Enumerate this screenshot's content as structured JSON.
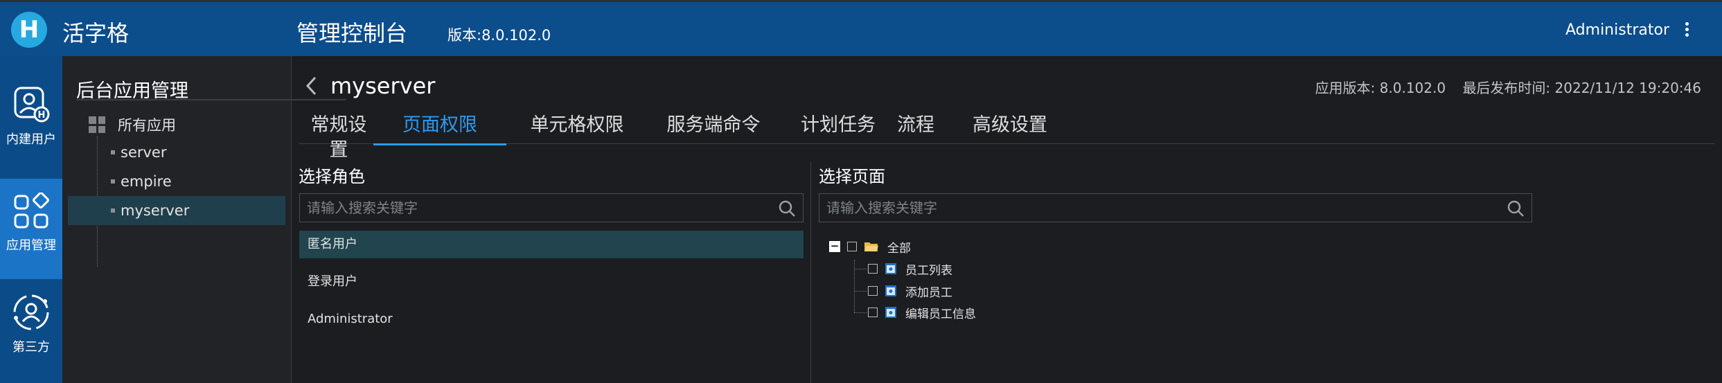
{
  "header": {
    "app_name": "活字格",
    "console_title": "管理控制台",
    "version": "版本:8.0.102.0",
    "user": "Administrator",
    "logo_letter": "H"
  },
  "leftnav": {
    "items": [
      {
        "label": "内建用户",
        "icon": "builtin-user-icon"
      },
      {
        "label": "应用管理",
        "icon": "app-management-icon",
        "active": true
      },
      {
        "label": "第三方",
        "icon": "third-party-icon"
      }
    ]
  },
  "apps": {
    "title": "后台应用管理",
    "root_label": "所有应用",
    "items": [
      "server",
      "empire",
      "myserver"
    ],
    "selected": "myserver"
  },
  "main": {
    "app_title": "myserver",
    "app_version": "应用版本: 8.0.102.0",
    "last_publish": "最后发布时间: 2022/11/12 19:20:46",
    "tabs": [
      "常规设置",
      "页面权限",
      "单元格权限",
      "服务端命令",
      "计划任务",
      "流程",
      "高级设置"
    ],
    "active_tab": "页面权限"
  },
  "roles": {
    "title": "选择角色",
    "search_placeholder": "请输入搜索关键字",
    "items": [
      "匿名用户",
      "登录用户",
      "Administrator"
    ],
    "selected": "匿名用户"
  },
  "pages": {
    "title": "选择页面",
    "search_placeholder": "请输入搜索关键字",
    "root_label": "全部",
    "items": [
      "员工列表",
      "添加员工",
      "编辑员工信息"
    ]
  },
  "colors": {
    "header_bg": "#0c4d8c",
    "accent": "#2b9bf4",
    "selected_row": "#21444f",
    "background": "#1b1d20"
  }
}
